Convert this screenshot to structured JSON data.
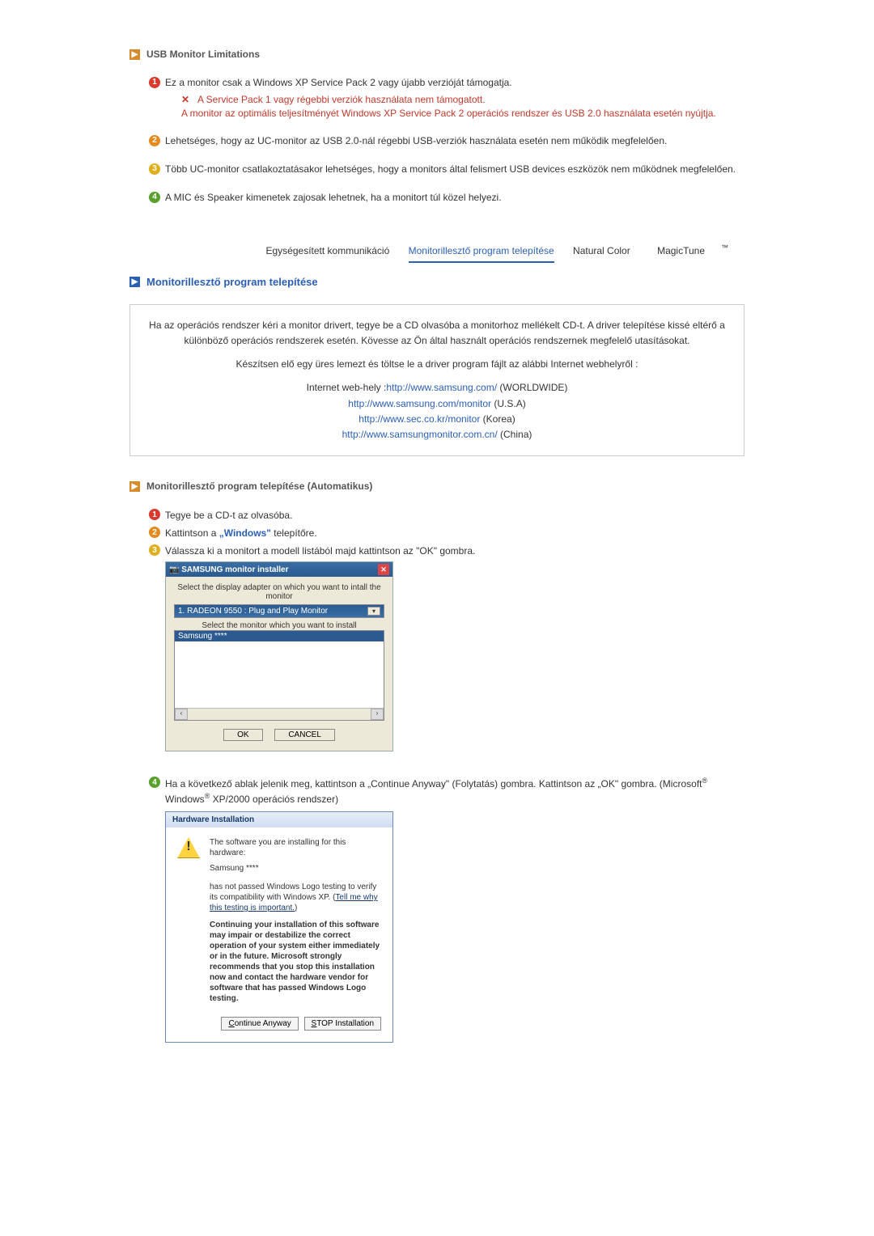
{
  "section1": {
    "title": "USB Monitor Limitations",
    "items": [
      {
        "main": "Ez a monitor csak a Windows XP Service Pack 2 vagy újabb verzióját támogatja.",
        "sub_red": "A Service Pack 1 vagy régebbi verziók használata nem támogatott.",
        "sub_plain": "A monitor az optimális teljesítményét Windows XP Service Pack 2 operációs rendszer és USB 2.0 használata esetén nyújtja."
      },
      {
        "main": "Lehetséges, hogy az UC-monitor az USB 2.0-nál régebbi USB-verziók használata esetén nem működik megfelelően."
      },
      {
        "main": "Több UC-monitor csatlakoztatásakor lehetséges, hogy a monitors által felismert USB devices eszközök nem működnek megfelelően."
      },
      {
        "main": "A MIC és Speaker kimenetek zajosak lehetnek, ha a monitort túl közel helyezi."
      }
    ]
  },
  "tabs": {
    "t1": "Egységesített kommunikáció",
    "t2_active": "Monitorillesztő program telepítése",
    "t3": "Natural Color",
    "t4": "MagicTune"
  },
  "section2": {
    "title": "Monitorillesztő program telepítése",
    "box_p1": "Ha az operációs rendszer kéri a monitor drivert, tegye be a CD olvasóba a monitorhoz mellékelt CD-t. A driver telepítése kissé eltérő a különböző operációs rendszerek esetén. Kövesse az Ön által használt operációs rendszernek megfelelő utasításokat.",
    "box_p2": "Készítsen elő egy üres lemezt és töltse le a driver program fájlt az alábbi Internet webhelyről :",
    "box_label": "Internet web-hely :",
    "links": {
      "l1": "http://www.samsung.com/",
      "l1_suffix": " (WORLDWIDE)",
      "l2": "http://www.samsung.com/monitor",
      "l2_suffix": " (U.S.A)",
      "l3": "http://www.sec.co.kr/monitor",
      "l3_suffix": " (Korea)",
      "l4": "http://www.samsungmonitor.com.cn/",
      "l4_suffix": " (China)"
    }
  },
  "section3": {
    "title": "Monitorillesztő program telepítése (Automatikus)",
    "steps": {
      "s1": "Tegye be a CD-t az olvasóba.",
      "s2_a": "Kattintson a ",
      "s2_link": "„Windows\"",
      "s2_b": " telepítőre.",
      "s3": "Válassza ki a monitort a modell listából majd kattintson az \"OK\" gombra.",
      "s4_a": "Ha a következő ablak jelenik meg, kattintson a „Continue Anyway\" (Folytatás) gombra. Kattintson az „OK\" gombra. (Microsoft",
      "s4_b": " Windows",
      "s4_c": " XP/2000 operációs rendszer)"
    }
  },
  "dlg1": {
    "title": "SAMSUNG monitor installer",
    "line1": "Select the display adapter on which you want to intall the monitor",
    "combo": "1. RADEON 9550 : Plug and Play Monitor",
    "line2": "Select the monitor which you want to install",
    "sel": "Samsung ****",
    "ok": "OK",
    "cancel": "CANCEL"
  },
  "dlg2": {
    "title": "Hardware Installation",
    "p1": "The software you are installing for this hardware:",
    "p2": "Samsung ****",
    "p3a": "has not passed Windows Logo testing to verify its compatibility with Windows XP. (",
    "p3link": "Tell me why this testing is important.",
    "p3b": ")",
    "bold": "Continuing your installation of this software may impair or destabilize the correct operation of your system either immediately or in the future. Microsoft strongly recommends that you stop this installation now and contact the hardware vendor for software that has passed Windows Logo testing.",
    "btn1": "Continue Anyway",
    "btn2": "STOP Installation"
  }
}
